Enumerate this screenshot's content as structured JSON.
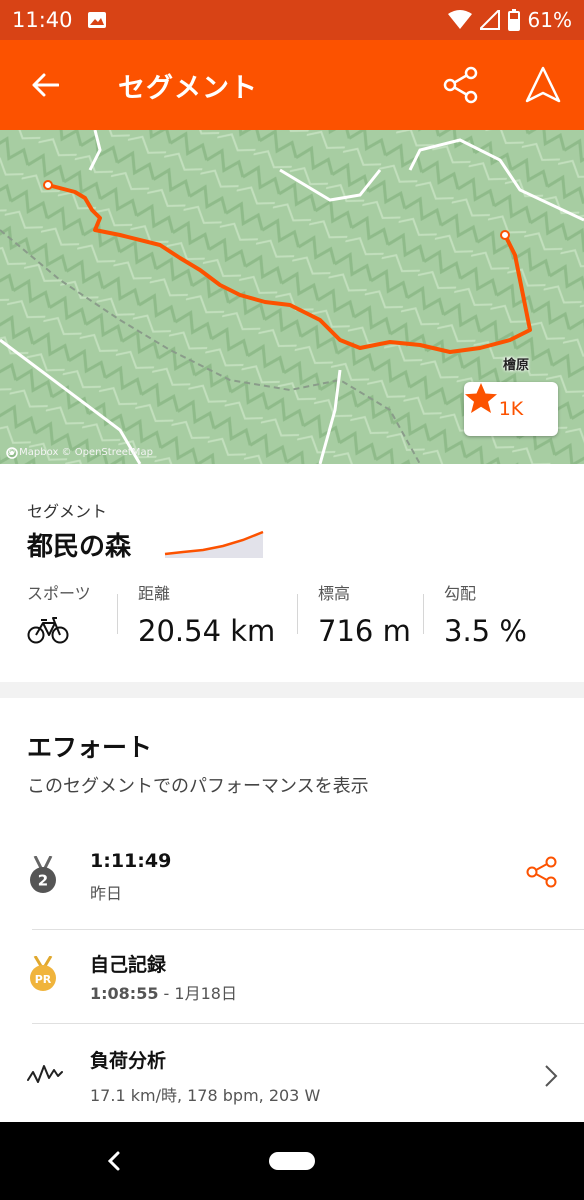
{
  "status_bar": {
    "time": "11:40",
    "battery": "61%"
  },
  "app_bar": {
    "title": "セグメント"
  },
  "map": {
    "place_label": "檜原",
    "attribution": "© Mapbox © OpenStreetMap",
    "star_count": "1K"
  },
  "segment": {
    "eyebrow": "セグメント",
    "name": "都民の森",
    "stats": [
      {
        "label": "スポーツ",
        "icon": "bike-icon"
      },
      {
        "label": "距離",
        "value": "20.54 km"
      },
      {
        "label": "標高",
        "value": "716 m"
      },
      {
        "label": "勾配",
        "value": "3.5 %"
      }
    ]
  },
  "effort": {
    "heading": "エフォート",
    "subtitle": "このセグメントでのパフォーマンスを表示",
    "rows": [
      {
        "icon": "medal-icon",
        "badge": "2",
        "title": "1:11:49",
        "detail": "昨日"
      },
      {
        "icon": "pr-icon",
        "badge": "PR",
        "title": "自己記録",
        "detail_time": "1:08:55",
        "detail_date": " - 1月18日"
      },
      {
        "icon": "pulse-icon",
        "title": "負荷分析",
        "detail": "17.1 km/時, 178 bpm, 203 W"
      }
    ]
  },
  "colors": {
    "brand": "#fc5200",
    "status_bar": "#d84315",
    "route": "#fc5200",
    "map": "#a9cfa4"
  }
}
